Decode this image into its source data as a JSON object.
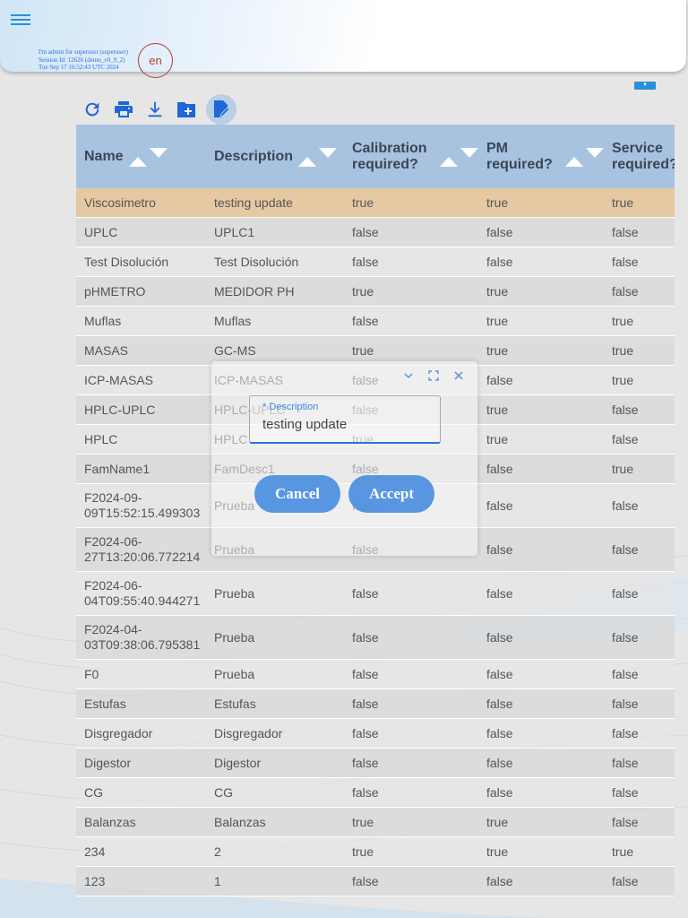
{
  "header": {
    "session_lines": [
      "I'm admin for superuser (superuser)",
      "Session Id: 12626 (demo_v0_9_2)",
      "Tue Sep 17 16:52:43 UTC 2024"
    ],
    "language": "en"
  },
  "toolbar": {
    "icons": [
      "refresh-icon",
      "print-icon",
      "download-icon",
      "new-folder-icon",
      "edit-document-icon"
    ]
  },
  "table": {
    "columns": [
      "Name",
      "Description",
      "Calibration required?",
      "PM required?",
      "Service required?"
    ],
    "rows": [
      [
        "Viscosimetro",
        "testing update",
        "true",
        "true",
        "true"
      ],
      [
        "UPLC",
        "UPLC1",
        "false",
        "false",
        "false"
      ],
      [
        "Test Disolución",
        "Test Disolución",
        "false",
        "false",
        "false"
      ],
      [
        "pHMETRO",
        "MEDIDOR PH",
        "true",
        "true",
        "false"
      ],
      [
        "Muflas",
        "Muflas",
        "false",
        "true",
        "true"
      ],
      [
        "MASAS",
        "GC-MS",
        "true",
        "true",
        "true"
      ],
      [
        "ICP-MASAS",
        "ICP-MASAS",
        "false",
        "false",
        "true"
      ],
      [
        "HPLC-UPLC",
        "HPLC-UPLC",
        "false",
        "true",
        "false"
      ],
      [
        "HPLC",
        "HPLC",
        "true",
        "true",
        "false"
      ],
      [
        "FamName1",
        "FamDesc1",
        "false",
        "false",
        "true"
      ],
      [
        "F2024-09-09T15:52:15.499303",
        "Prueba",
        "false",
        "false",
        "false"
      ],
      [
        "F2024-06-27T13:20:06.772214",
        "Prueba",
        "false",
        "false",
        "false"
      ],
      [
        "F2024-06-04T09:55:40.944271",
        "Prueba",
        "false",
        "false",
        "false"
      ],
      [
        "F2024-04-03T09:38:06.795381",
        "Prueba",
        "false",
        "false",
        "false"
      ],
      [
        "F0",
        "Prueba",
        "false",
        "false",
        "false"
      ],
      [
        "Estufas",
        "Estufas",
        "false",
        "false",
        "false"
      ],
      [
        "Disgregador",
        "Disgregador",
        "false",
        "false",
        "false"
      ],
      [
        "Digestor",
        "Digestor",
        "false",
        "false",
        "false"
      ],
      [
        "CG",
        "CG",
        "false",
        "false",
        "false"
      ],
      [
        "Balanzas",
        "Balanzas",
        "true",
        "true",
        "false"
      ],
      [
        "234",
        "2",
        "true",
        "true",
        "true"
      ],
      [
        "123",
        "1",
        "false",
        "false",
        "false"
      ]
    ],
    "selected_row": 0
  },
  "dialog": {
    "field_label": "* Description",
    "field_value": "testing update",
    "cancel_label": "Cancel",
    "accept_label": "Accept"
  },
  "colors": {
    "accent": "#2f6fe0",
    "header_bg": "#a8c3e0",
    "selected_row": "#e6c9a3",
    "button": "#4d90e0"
  }
}
